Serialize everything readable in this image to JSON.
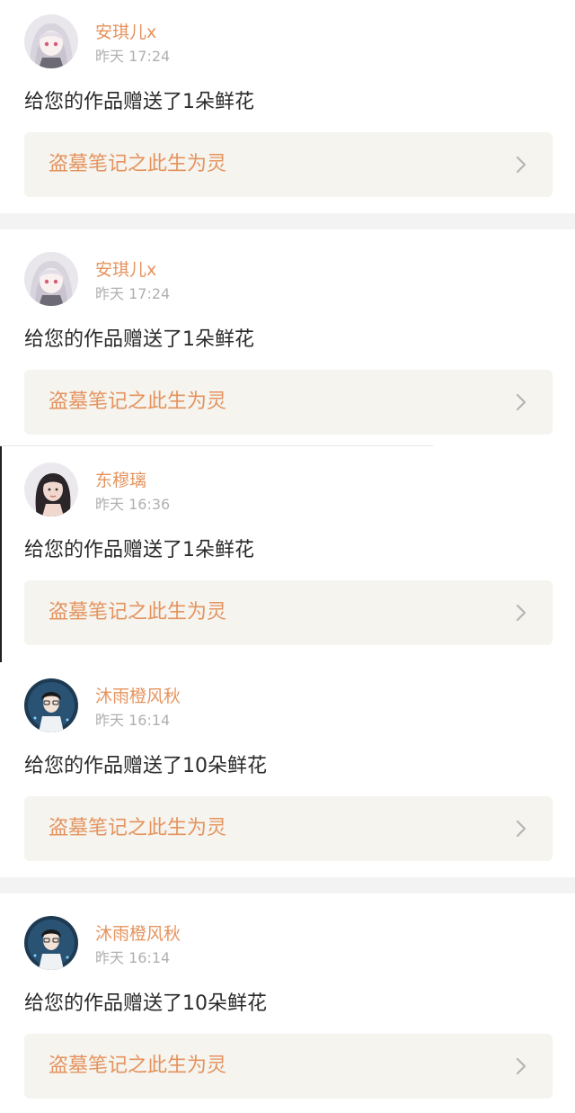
{
  "notifications": [
    {
      "username": "安琪儿x",
      "time": "昨天 17:24",
      "message": "给您的作品赠送了1朵鲜花",
      "work_title": "盗墓笔记之此生为灵",
      "avatar_icon": "anime-girl-avatar-icon",
      "arrow_icon": "chevron-right-icon"
    },
    {
      "username": "安琪儿x",
      "time": "昨天 17:24",
      "message": "给您的作品赠送了1朵鲜花",
      "work_title": "盗墓笔记之此生为灵",
      "avatar_icon": "anime-girl-avatar-icon",
      "arrow_icon": "chevron-right-icon"
    },
    {
      "username": "东穆璃",
      "time": "昨天 16:36",
      "message": "给您的作品赠送了1朵鲜花",
      "work_title": "盗墓笔记之此生为灵",
      "avatar_icon": "woman-portrait-avatar-icon",
      "arrow_icon": "chevron-right-icon"
    },
    {
      "username": "沐雨橙风秋",
      "time": "昨天 16:14",
      "message": "给您的作品赠送了10朵鲜花",
      "work_title": "盗墓笔记之此生为灵",
      "avatar_icon": "anime-boy-avatar-icon",
      "arrow_icon": "chevron-right-icon"
    },
    {
      "username": "沐雨橙风秋",
      "time": "昨天 16:14",
      "message": "给您的作品赠送了10朵鲜花",
      "work_title": "盗墓笔记之此生为灵",
      "avatar_icon": "anime-boy-avatar-icon",
      "arrow_icon": "chevron-right-icon"
    }
  ],
  "colors": {
    "username": "#e5935e",
    "timestamp": "#b0b0b0",
    "message": "#2a2a2a",
    "work_title": "#e5935e",
    "link_background": "#f5f4ef",
    "separator_band": "#f3f3f3"
  }
}
